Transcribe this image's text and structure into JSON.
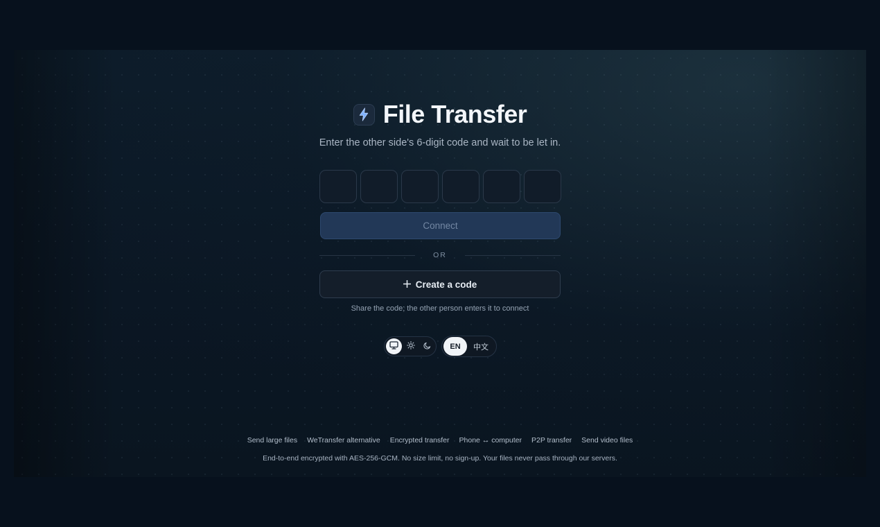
{
  "app": {
    "title": "File Transfer",
    "subtitle": "Enter the other side's 6-digit code and wait to be let in."
  },
  "code_input": {
    "digits": [
      "",
      "",
      "",
      "",
      "",
      ""
    ]
  },
  "actions": {
    "connect_label": "Connect",
    "divider_label": "OR",
    "create_label": "Create a code",
    "create_hint": "Share the code; the other person enters it to connect"
  },
  "theme_switch": {
    "options": [
      "system",
      "light",
      "dark"
    ],
    "selected": "system"
  },
  "language_switch": {
    "options": [
      "EN",
      "中文"
    ],
    "selected": "EN"
  },
  "footer": {
    "links": [
      "Send large files",
      "WeTransfer alternative",
      "Encrypted transfer",
      "Phone ↔ computer",
      "P2P transfer",
      "Send video files"
    ],
    "note": "End-to-end encrypted with AES-256-GCM. No size limit, no sign-up. Your files never pass through our servers."
  },
  "colors": {
    "background": "#07111d",
    "accent": "#223857",
    "logo_bolt": "#7fb2ff"
  }
}
